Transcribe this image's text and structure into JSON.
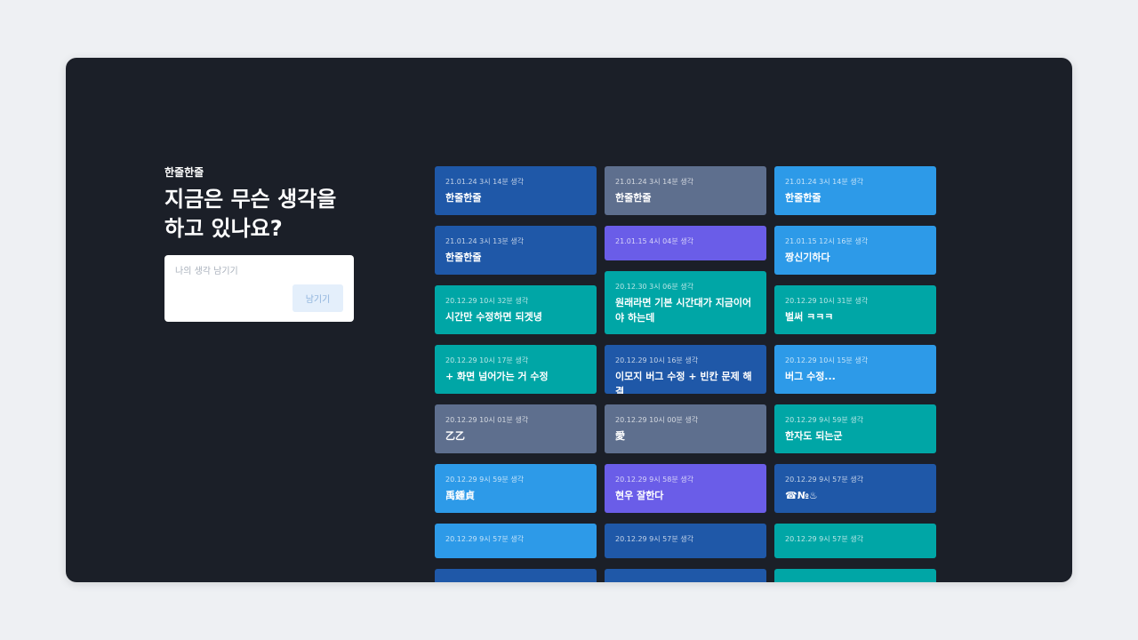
{
  "brand": "한줄한줄",
  "headline": {
    "line1": "지금은 무슨 생각을",
    "line2": "하고 있나요?"
  },
  "composer": {
    "placeholder": "나의 생각 남기기",
    "value": "",
    "submit_label": "남기기"
  },
  "colors": {
    "page_background": "#eef0f3",
    "window_background": "#1b1f28",
    "navy": "#1f58a8",
    "slate": "#5e6f8e",
    "sky": "#2d9ae8",
    "violet": "#6a5de8",
    "teal": "#00a6a6"
  },
  "columns": [
    {
      "cards": [
        {
          "time": "21.01.24 3시 14분 생각",
          "text": "한줄한줄",
          "color": "#1f58a8"
        },
        {
          "time": "21.01.24 3시 13분 생각",
          "text": "한줄한줄",
          "color": "#1f58a8"
        },
        {
          "time": "20.12.29 10시 32분 생각",
          "text": "시간만 수정하면 되겟녕",
          "color": "#00a6a6"
        },
        {
          "time": "20.12.29 10시 17분 생각",
          "text": "+ 화면 넘어가는 거 수정",
          "color": "#00a6a6"
        },
        {
          "time": "20.12.29 10시 01분 생각",
          "text": "乙乙",
          "color": "#5e6f8e"
        },
        {
          "time": "20.12.29 9시 59분 생각",
          "text": "禹鍾貞",
          "color": "#2d9ae8"
        },
        {
          "time": "20.12.29 9시 57분 생각",
          "text": "",
          "color": "#2d9ae8"
        },
        {
          "time": "",
          "text": "",
          "color": "#1f58a8"
        }
      ]
    },
    {
      "cards": [
        {
          "time": "21.01.24 3시 14분 생각",
          "text": "한줄한줄",
          "color": "#5e6f8e"
        },
        {
          "time": "21.01.15 4시 04분 생각",
          "text": "",
          "color": "#6a5de8"
        },
        {
          "time": "20.12.30 3시 06분 생각",
          "text": "원래라면 기본 시간대가 지금이어야 하는데",
          "color": "#00a6a6"
        },
        {
          "time": "20.12.29 10시 16분 생각",
          "text": "이모지 버그 수정 + 빈칸 문제 해결",
          "color": "#1f58a8"
        },
        {
          "time": "20.12.29 10시 00분 생각",
          "text": "愛",
          "color": "#5e6f8e"
        },
        {
          "time": "20.12.29 9시 58분 생각",
          "text": "현우 잘한다",
          "color": "#6a5de8"
        },
        {
          "time": "20.12.29 9시 57분 생각",
          "text": "",
          "color": "#1f58a8"
        },
        {
          "time": "",
          "text": "",
          "color": "#1f58a8"
        }
      ]
    },
    {
      "cards": [
        {
          "time": "21.01.24 3시 14분 생각",
          "text": "한줄한줄",
          "color": "#2d9ae8"
        },
        {
          "time": "21.01.15 12시 16분 생각",
          "text": "짱신기하다",
          "color": "#2d9ae8"
        },
        {
          "time": "20.12.29 10시 31분 생각",
          "text": "벌써 ㅋㅋㅋ",
          "color": "#00a6a6"
        },
        {
          "time": "20.12.29 10시 15분 생각",
          "text": "버그 수정...",
          "color": "#2d9ae8"
        },
        {
          "time": "20.12.29 9시 59분 생각",
          "text": "한자도 되는군",
          "color": "#00a6a6"
        },
        {
          "time": "20.12.29 9시 57분 생각",
          "text": "☎№♨",
          "color": "#1f58a8"
        },
        {
          "time": "20.12.29 9시 57분 생각",
          "text": "",
          "color": "#00a6a6"
        },
        {
          "time": "",
          "text": "",
          "color": "#00a6a6"
        }
      ]
    }
  ]
}
